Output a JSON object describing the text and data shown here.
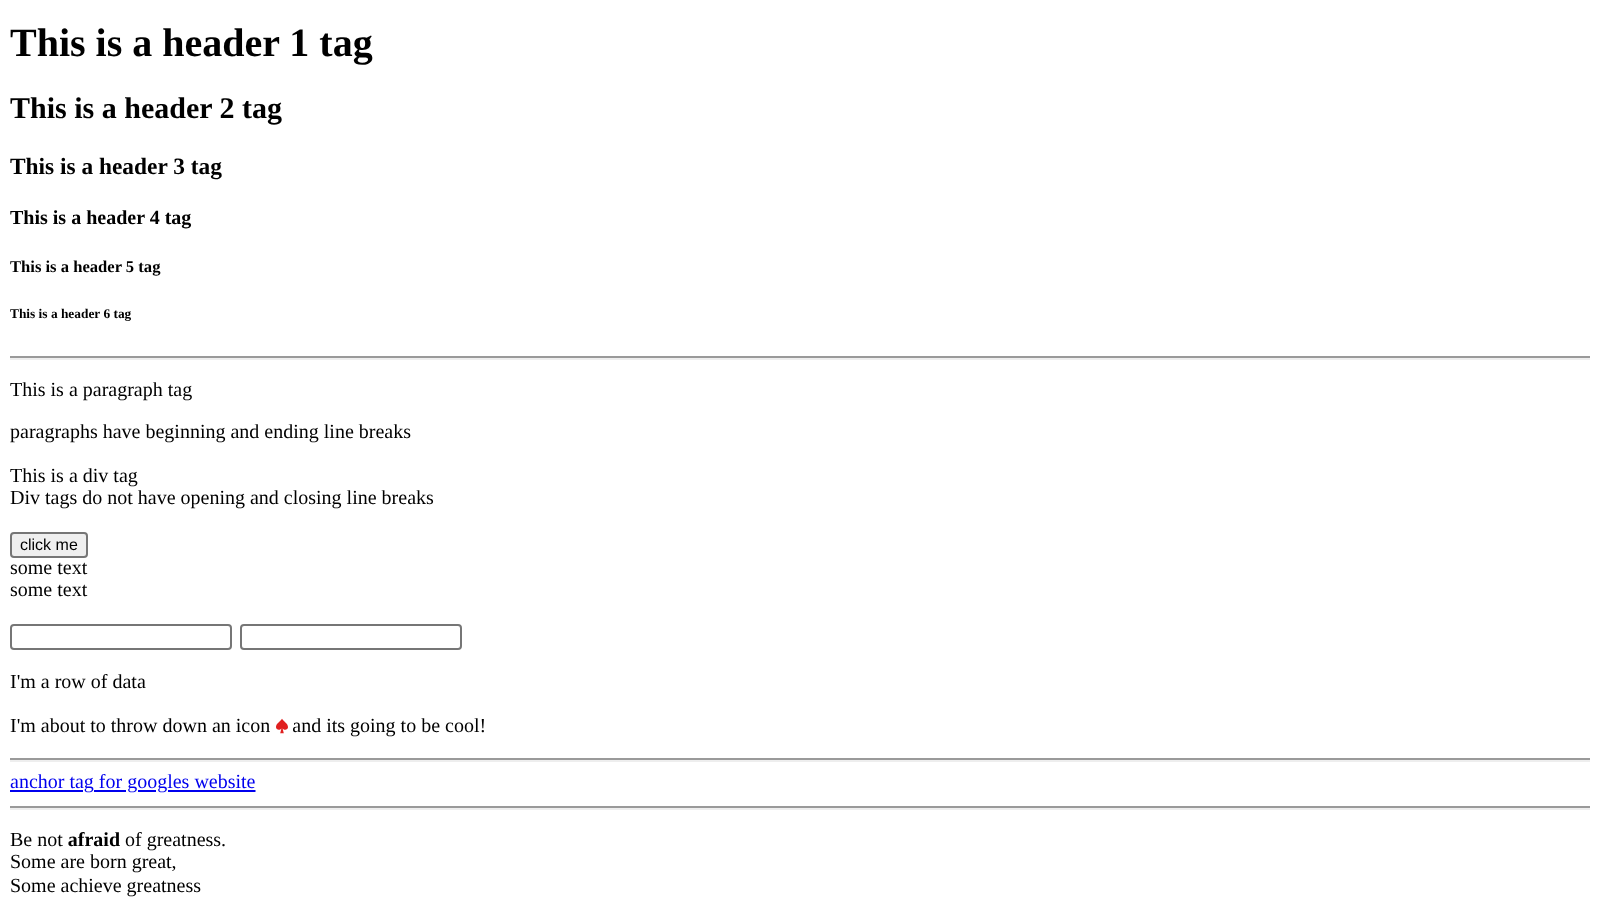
{
  "headings": [
    "This is a header 1 tag",
    "This is a header 2 tag",
    "This is a header 3 tag",
    "This is a header 4 tag",
    "This is a header 5 tag",
    "This is a header 6 tag"
  ],
  "paragraphs": [
    "This is a paragraph tag",
    "paragraphs have beginning and ending line breaks"
  ],
  "div_lines": [
    "This is a div tag",
    "Div tags do not have opening and closing line breaks"
  ],
  "button": "click me",
  "some_text": [
    "some text",
    "some text"
  ],
  "row_text": "I'm a row of data",
  "icon_sentence": {
    "before": "I'm about to throw down an icon",
    "after": "and its going to be cool!"
  },
  "link": "anchor tag for googles website",
  "poem": [
    "Be not **afraid** of greatness.",
    "Some are born great,",
    "Some achieve greatness"
  ]
}
